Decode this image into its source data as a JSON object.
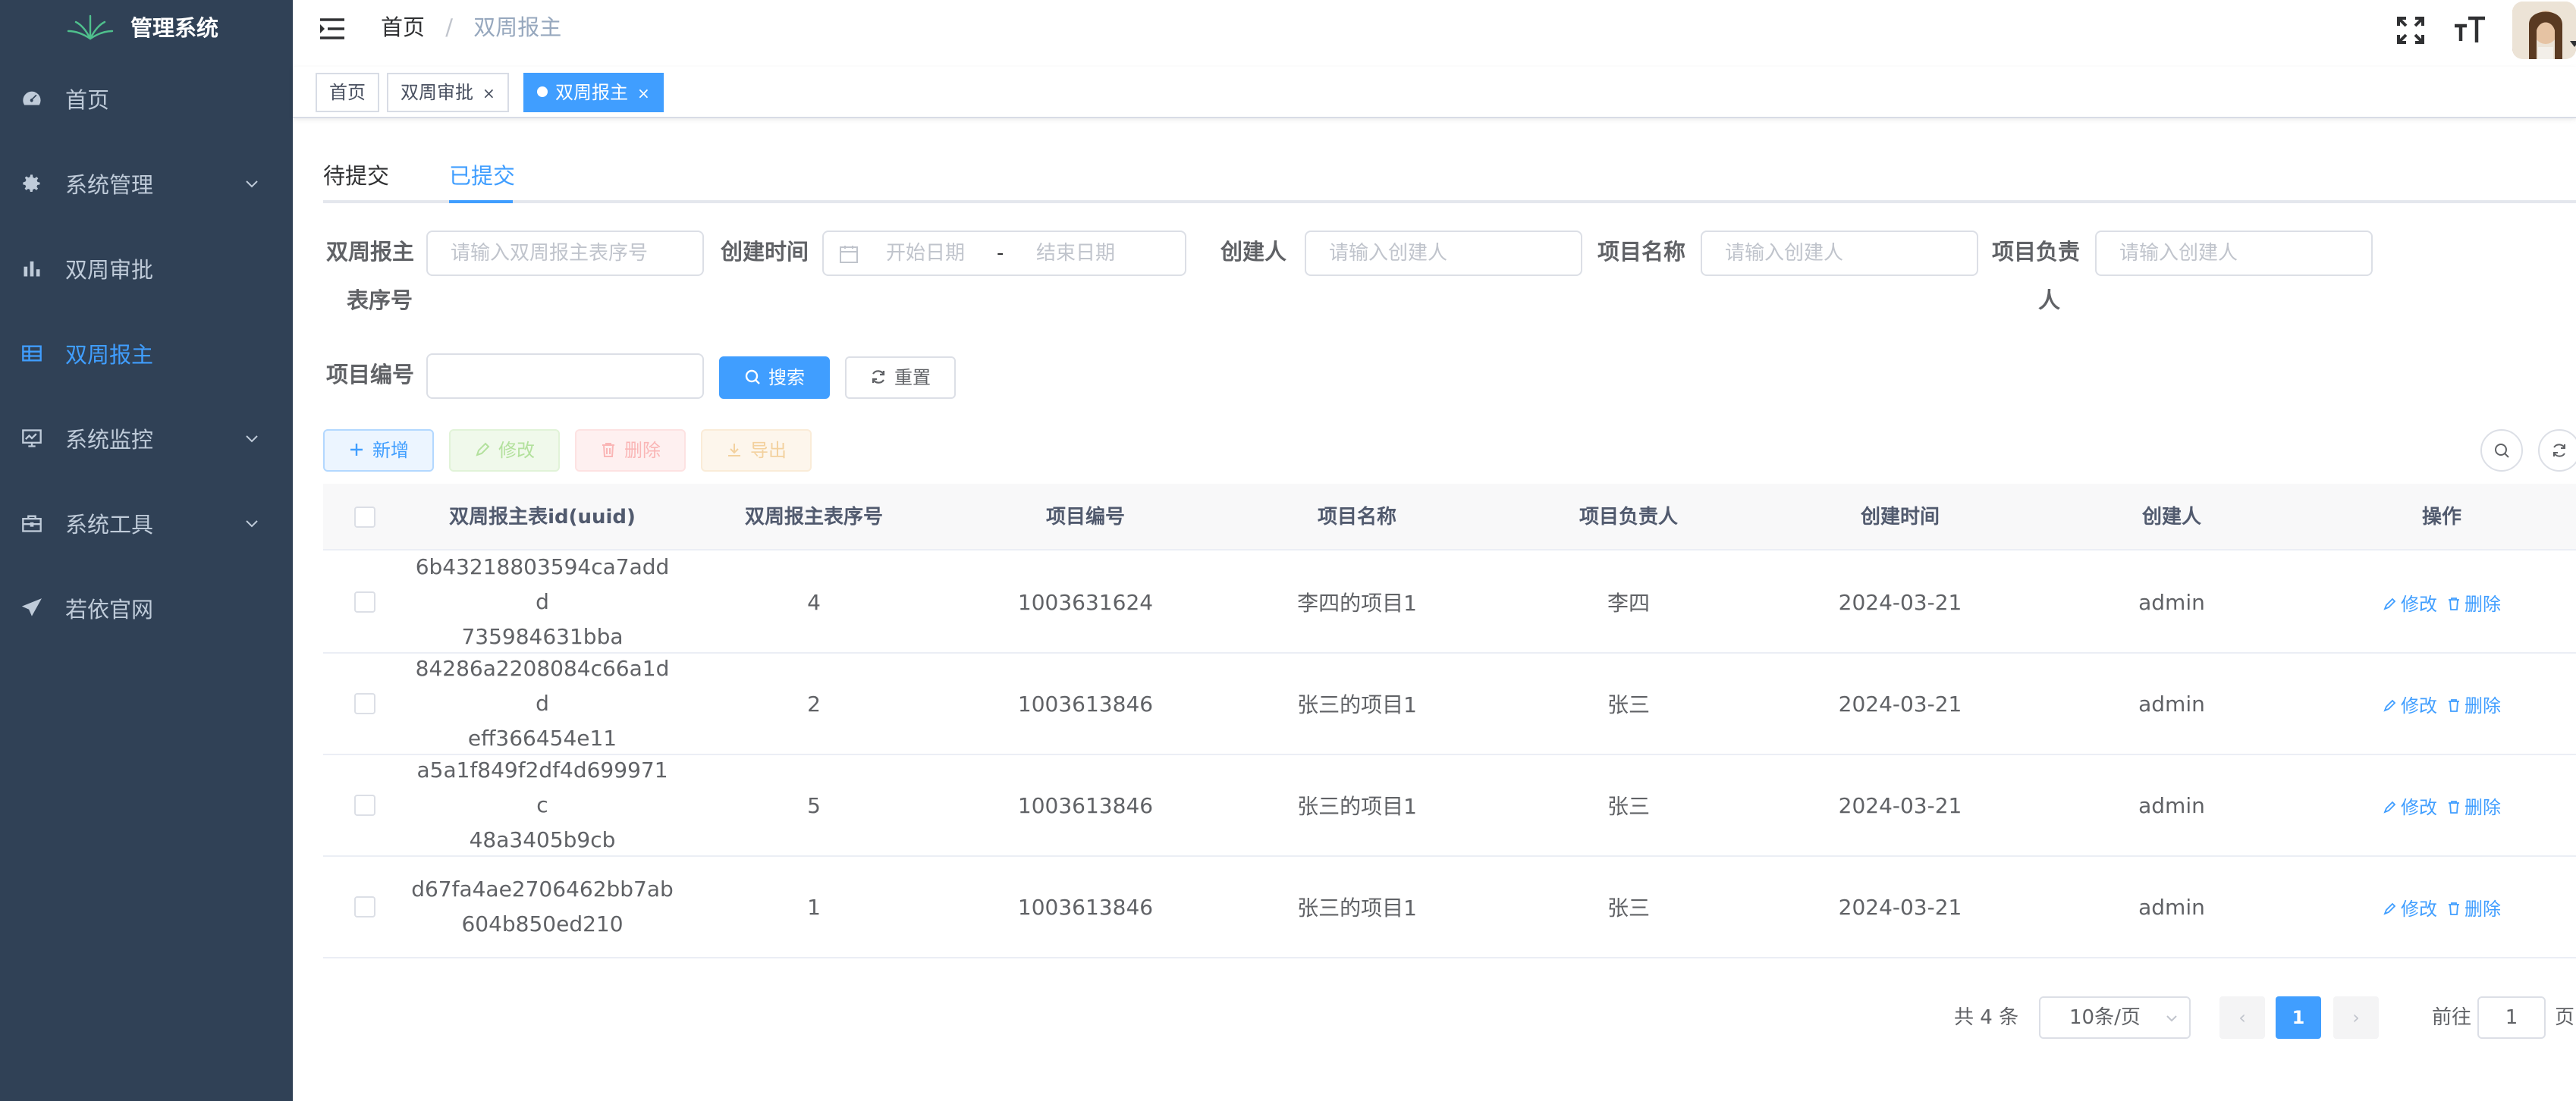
{
  "sidebar": {
    "title": "管理系统",
    "items": [
      {
        "label": "首页",
        "icon": "dashboard-icon",
        "has_arrow": false,
        "active": false
      },
      {
        "label": "系统管理",
        "icon": "gear-icon",
        "has_arrow": true,
        "active": false
      },
      {
        "label": "双周审批",
        "icon": "bar-chart-icon",
        "has_arrow": false,
        "active": false
      },
      {
        "label": "双周报主",
        "icon": "table-icon",
        "has_arrow": false,
        "active": true
      },
      {
        "label": "系统监控",
        "icon": "monitor-icon",
        "has_arrow": true,
        "active": false
      },
      {
        "label": "系统工具",
        "icon": "toolbox-icon",
        "has_arrow": true,
        "active": false
      },
      {
        "label": "若依官网",
        "icon": "send-icon",
        "has_arrow": false,
        "active": false
      }
    ]
  },
  "navbar": {
    "breadcrumb_home": "首页",
    "breadcrumb_sep": "/",
    "breadcrumb_current": "双周报主"
  },
  "tags": [
    {
      "label": "首页",
      "closable": false,
      "active": false
    },
    {
      "label": "双周审批",
      "closable": true,
      "active": false
    },
    {
      "label": "双周报主",
      "closable": true,
      "active": true
    }
  ],
  "tab_close_glyph": "×",
  "tabs": {
    "pending": "待提交",
    "submitted": "已提交",
    "active": "submitted"
  },
  "search": {
    "serial_label_1": "双周报主",
    "serial_label_2": "表序号",
    "serial_placeholder": "请输入双周报主表序号",
    "created_time_label": "创建时间",
    "date_start": "开始日期",
    "date_sep": "-",
    "date_end": "结束日期",
    "creator_label": "创建人",
    "creator_placeholder": "请输入创建人",
    "project_name_label": "项目名称",
    "project_name_placeholder": "请输入创建人",
    "owner_label_1": "项目负责",
    "owner_label_2": "人",
    "owner_placeholder": "请输入创建人",
    "project_no_label": "项目编号",
    "project_no_value": "",
    "search_button": "搜索",
    "reset_button": "重置"
  },
  "toolbar": {
    "add": "新增",
    "edit": "修改",
    "delete": "删除",
    "export": "导出"
  },
  "table": {
    "columns": [
      "双周报主表id(uuid)",
      "双周报主表序号",
      "项目编号",
      "项目名称",
      "项目负责人",
      "创建时间",
      "创建人",
      "操作"
    ],
    "rows": [
      {
        "uuid_1": "6b43218803594ca7addd",
        "uuid_2": "735984631bba",
        "serial": "4",
        "project_no": "1003631624",
        "project_name": "李四的项目1",
        "owner": "李四",
        "created": "2024-03-21",
        "creator": "admin"
      },
      {
        "uuid_1": "84286a2208084c66a1dd",
        "uuid_2": "eff366454e11",
        "serial": "2",
        "project_no": "1003613846",
        "project_name": "张三的项目1",
        "owner": "张三",
        "created": "2024-03-21",
        "creator": "admin"
      },
      {
        "uuid_1": "a5a1f849f2df4d699971c",
        "uuid_2": "48a3405b9cb",
        "serial": "5",
        "project_no": "1003613846",
        "project_name": "张三的项目1",
        "owner": "张三",
        "created": "2024-03-21",
        "creator": "admin"
      },
      {
        "uuid_1": "d67fa4ae2706462bb7ab",
        "uuid_2": "604b850ed210",
        "serial": "1",
        "project_no": "1003613846",
        "project_name": "张三的项目1",
        "owner": "张三",
        "created": "2024-03-21",
        "creator": "admin"
      }
    ],
    "op_edit": "修改",
    "op_delete": "删除"
  },
  "pagination": {
    "total": "共 4 条",
    "page_size": "10条/页",
    "prev": "‹",
    "current": "1",
    "next": "›",
    "goto_label": "前往",
    "goto_value": "1",
    "page_suffix": "页"
  },
  "colors": {
    "sidebar_bg": "#304156",
    "primary": "#409eff",
    "sidebar_text": "#bfcbd9"
  }
}
